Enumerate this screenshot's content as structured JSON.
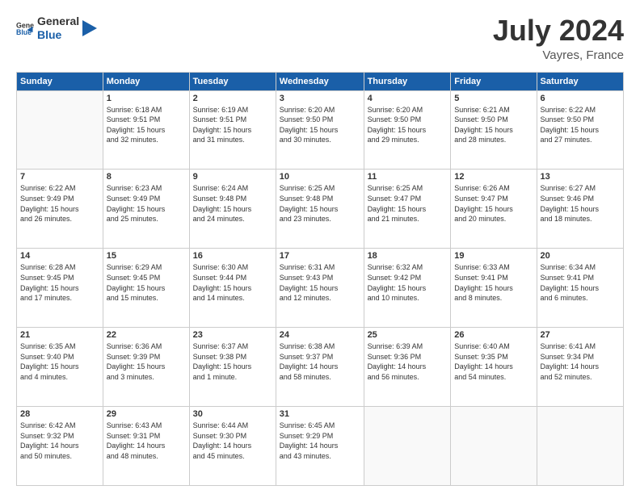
{
  "logo": {
    "text_general": "General",
    "text_blue": "Blue"
  },
  "title": "July 2024",
  "subtitle": "Vayres, France",
  "days_of_week": [
    "Sunday",
    "Monday",
    "Tuesday",
    "Wednesday",
    "Thursday",
    "Friday",
    "Saturday"
  ],
  "weeks": [
    [
      {
        "day": "",
        "sunrise": "",
        "sunset": "",
        "daylight": ""
      },
      {
        "day": "1",
        "sunrise": "Sunrise: 6:18 AM",
        "sunset": "Sunset: 9:51 PM",
        "daylight": "Daylight: 15 hours and 32 minutes."
      },
      {
        "day": "2",
        "sunrise": "Sunrise: 6:19 AM",
        "sunset": "Sunset: 9:51 PM",
        "daylight": "Daylight: 15 hours and 31 minutes."
      },
      {
        "day": "3",
        "sunrise": "Sunrise: 6:20 AM",
        "sunset": "Sunset: 9:50 PM",
        "daylight": "Daylight: 15 hours and 30 minutes."
      },
      {
        "day": "4",
        "sunrise": "Sunrise: 6:20 AM",
        "sunset": "Sunset: 9:50 PM",
        "daylight": "Daylight: 15 hours and 29 minutes."
      },
      {
        "day": "5",
        "sunrise": "Sunrise: 6:21 AM",
        "sunset": "Sunset: 9:50 PM",
        "daylight": "Daylight: 15 hours and 28 minutes."
      },
      {
        "day": "6",
        "sunrise": "Sunrise: 6:22 AM",
        "sunset": "Sunset: 9:50 PM",
        "daylight": "Daylight: 15 hours and 27 minutes."
      }
    ],
    [
      {
        "day": "7",
        "sunrise": "Sunrise: 6:22 AM",
        "sunset": "Sunset: 9:49 PM",
        "daylight": "Daylight: 15 hours and 26 minutes."
      },
      {
        "day": "8",
        "sunrise": "Sunrise: 6:23 AM",
        "sunset": "Sunset: 9:49 PM",
        "daylight": "Daylight: 15 hours and 25 minutes."
      },
      {
        "day": "9",
        "sunrise": "Sunrise: 6:24 AM",
        "sunset": "Sunset: 9:48 PM",
        "daylight": "Daylight: 15 hours and 24 minutes."
      },
      {
        "day": "10",
        "sunrise": "Sunrise: 6:25 AM",
        "sunset": "Sunset: 9:48 PM",
        "daylight": "Daylight: 15 hours and 23 minutes."
      },
      {
        "day": "11",
        "sunrise": "Sunrise: 6:25 AM",
        "sunset": "Sunset: 9:47 PM",
        "daylight": "Daylight: 15 hours and 21 minutes."
      },
      {
        "day": "12",
        "sunrise": "Sunrise: 6:26 AM",
        "sunset": "Sunset: 9:47 PM",
        "daylight": "Daylight: 15 hours and 20 minutes."
      },
      {
        "day": "13",
        "sunrise": "Sunrise: 6:27 AM",
        "sunset": "Sunset: 9:46 PM",
        "daylight": "Daylight: 15 hours and 18 minutes."
      }
    ],
    [
      {
        "day": "14",
        "sunrise": "Sunrise: 6:28 AM",
        "sunset": "Sunset: 9:45 PM",
        "daylight": "Daylight: 15 hours and 17 minutes."
      },
      {
        "day": "15",
        "sunrise": "Sunrise: 6:29 AM",
        "sunset": "Sunset: 9:45 PM",
        "daylight": "Daylight: 15 hours and 15 minutes."
      },
      {
        "day": "16",
        "sunrise": "Sunrise: 6:30 AM",
        "sunset": "Sunset: 9:44 PM",
        "daylight": "Daylight: 15 hours and 14 minutes."
      },
      {
        "day": "17",
        "sunrise": "Sunrise: 6:31 AM",
        "sunset": "Sunset: 9:43 PM",
        "daylight": "Daylight: 15 hours and 12 minutes."
      },
      {
        "day": "18",
        "sunrise": "Sunrise: 6:32 AM",
        "sunset": "Sunset: 9:42 PM",
        "daylight": "Daylight: 15 hours and 10 minutes."
      },
      {
        "day": "19",
        "sunrise": "Sunrise: 6:33 AM",
        "sunset": "Sunset: 9:41 PM",
        "daylight": "Daylight: 15 hours and 8 minutes."
      },
      {
        "day": "20",
        "sunrise": "Sunrise: 6:34 AM",
        "sunset": "Sunset: 9:41 PM",
        "daylight": "Daylight: 15 hours and 6 minutes."
      }
    ],
    [
      {
        "day": "21",
        "sunrise": "Sunrise: 6:35 AM",
        "sunset": "Sunset: 9:40 PM",
        "daylight": "Daylight: 15 hours and 4 minutes."
      },
      {
        "day": "22",
        "sunrise": "Sunrise: 6:36 AM",
        "sunset": "Sunset: 9:39 PM",
        "daylight": "Daylight: 15 hours and 3 minutes."
      },
      {
        "day": "23",
        "sunrise": "Sunrise: 6:37 AM",
        "sunset": "Sunset: 9:38 PM",
        "daylight": "Daylight: 15 hours and 1 minute."
      },
      {
        "day": "24",
        "sunrise": "Sunrise: 6:38 AM",
        "sunset": "Sunset: 9:37 PM",
        "daylight": "Daylight: 14 hours and 58 minutes."
      },
      {
        "day": "25",
        "sunrise": "Sunrise: 6:39 AM",
        "sunset": "Sunset: 9:36 PM",
        "daylight": "Daylight: 14 hours and 56 minutes."
      },
      {
        "day": "26",
        "sunrise": "Sunrise: 6:40 AM",
        "sunset": "Sunset: 9:35 PM",
        "daylight": "Daylight: 14 hours and 54 minutes."
      },
      {
        "day": "27",
        "sunrise": "Sunrise: 6:41 AM",
        "sunset": "Sunset: 9:34 PM",
        "daylight": "Daylight: 14 hours and 52 minutes."
      }
    ],
    [
      {
        "day": "28",
        "sunrise": "Sunrise: 6:42 AM",
        "sunset": "Sunset: 9:32 PM",
        "daylight": "Daylight: 14 hours and 50 minutes."
      },
      {
        "day": "29",
        "sunrise": "Sunrise: 6:43 AM",
        "sunset": "Sunset: 9:31 PM",
        "daylight": "Daylight: 14 hours and 48 minutes."
      },
      {
        "day": "30",
        "sunrise": "Sunrise: 6:44 AM",
        "sunset": "Sunset: 9:30 PM",
        "daylight": "Daylight: 14 hours and 45 minutes."
      },
      {
        "day": "31",
        "sunrise": "Sunrise: 6:45 AM",
        "sunset": "Sunset: 9:29 PM",
        "daylight": "Daylight: 14 hours and 43 minutes."
      },
      {
        "day": "",
        "sunrise": "",
        "sunset": "",
        "daylight": ""
      },
      {
        "day": "",
        "sunrise": "",
        "sunset": "",
        "daylight": ""
      },
      {
        "day": "",
        "sunrise": "",
        "sunset": "",
        "daylight": ""
      }
    ]
  ]
}
